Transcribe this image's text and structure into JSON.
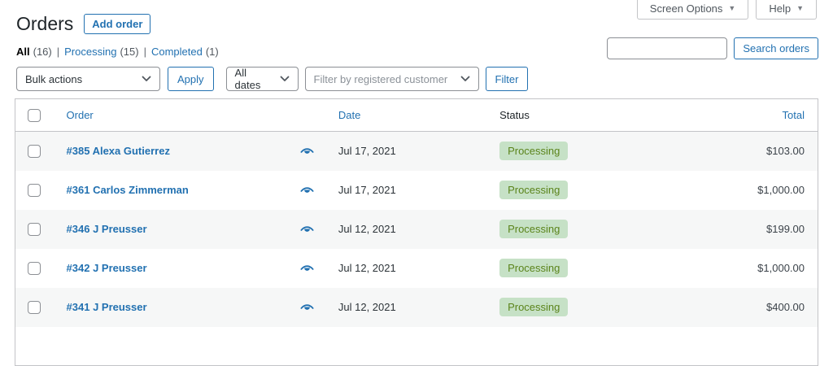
{
  "page": {
    "title": "Orders"
  },
  "meta_tabs": {
    "screen_options": "Screen Options",
    "help": "Help"
  },
  "header": {
    "add_order": "Add order"
  },
  "search": {
    "input_value": "",
    "button": "Search orders"
  },
  "views": [
    {
      "label": "All",
      "count": "(16)",
      "current": true
    },
    {
      "label": "Processing",
      "count": "(15)",
      "current": false
    },
    {
      "label": "Completed",
      "count": "(1)",
      "current": false
    }
  ],
  "filters": {
    "bulk_actions": "Bulk actions",
    "apply": "Apply",
    "all_dates": "All dates",
    "customer_placeholder": "Filter by registered customer",
    "filter": "Filter"
  },
  "table": {
    "columns": {
      "order": "Order",
      "date": "Date",
      "status": "Status",
      "total": "Total"
    },
    "rows": [
      {
        "order": "#385 Alexa Gutierrez",
        "date": "Jul 17, 2021",
        "status": "Processing",
        "total": "$103.00"
      },
      {
        "order": "#361 Carlos Zimmerman",
        "date": "Jul 17, 2021",
        "status": "Processing",
        "total": "$1,000.00"
      },
      {
        "order": "#346 J Preusser",
        "date": "Jul 12, 2021",
        "status": "Processing",
        "total": "$199.00"
      },
      {
        "order": "#342 J Preusser",
        "date": "Jul 12, 2021",
        "status": "Processing",
        "total": "$1,000.00"
      },
      {
        "order": "#341 J Preusser",
        "date": "Jul 12, 2021",
        "status": "Processing",
        "total": "$400.00"
      }
    ]
  },
  "colors": {
    "accent_blue": "#2271b1",
    "badge_bg": "#c6e1c6",
    "badge_text": "#5b841b",
    "row_alt": "#f6f7f7",
    "border": "#c3c4c7"
  }
}
